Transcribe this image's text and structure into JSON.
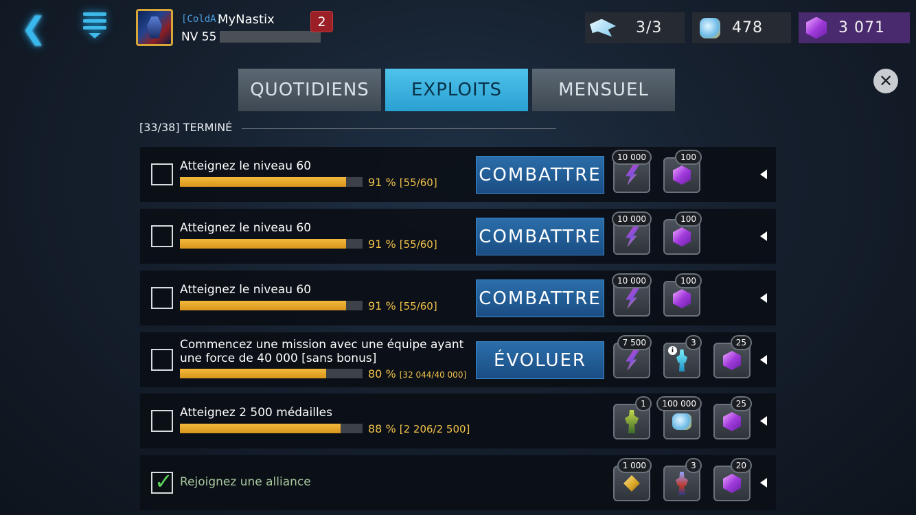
{
  "header": {
    "player_tag": "[ColdA]",
    "player_name": "MyNastix",
    "level": "NV 55",
    "notifications": "2",
    "resources": {
      "energy": "3/3",
      "crystals": "478",
      "gems": "3 071"
    }
  },
  "tabs": [
    {
      "label": "QUOTIDIENS",
      "active": false
    },
    {
      "label": "EXPLOITS",
      "active": true
    },
    {
      "label": "MENSUEL",
      "active": false
    }
  ],
  "summary": {
    "text": "[33/38] TERMINÉ"
  },
  "rows": [
    {
      "title": "Atteignez le niveau 60",
      "progress": 0.91,
      "percent": "91 %",
      "detail": "[55/60]",
      "button": "COMBATTRE",
      "completed": false,
      "rewards": [
        {
          "icon": "rainbow-bolt-icon",
          "count": "10 000"
        },
        {
          "icon": "purple-gem-icon",
          "count": "100"
        }
      ]
    },
    {
      "title": "Atteignez le niveau 60",
      "progress": 0.91,
      "percent": "91 %",
      "detail": "[55/60]",
      "button": "COMBATTRE",
      "completed": false,
      "rewards": [
        {
          "icon": "rainbow-bolt-icon",
          "count": "10 000"
        },
        {
          "icon": "purple-gem-icon",
          "count": "100"
        }
      ]
    },
    {
      "title": "Atteignez le niveau 60",
      "progress": 0.91,
      "percent": "91 %",
      "detail": "[55/60]",
      "button": "COMBATTRE",
      "completed": false,
      "rewards": [
        {
          "icon": "rainbow-bolt-icon",
          "count": "10 000"
        },
        {
          "icon": "purple-gem-icon",
          "count": "100"
        }
      ]
    },
    {
      "title_line1": "Commencez une mission avec une équipe ayant",
      "title_line2": "une force de 40 000 [sans bonus]",
      "progress": 0.8,
      "percent": "80 %",
      "detail": "[32 044/40 000]",
      "button": "ÉVOLUER",
      "completed": false,
      "rewards": [
        {
          "icon": "rainbow-bolt-icon",
          "count": "7 500"
        },
        {
          "icon": "blue-robot-icon",
          "count": "3"
        },
        {
          "icon": "purple-gem-icon",
          "count": "25"
        }
      ]
    },
    {
      "title": "Atteignez 2 500 médailles",
      "progress": 0.88,
      "percent": "88 %",
      "detail": "[2 206/2 500]",
      "completed": false,
      "rewards": [
        {
          "icon": "green-robot-icon",
          "count": "1"
        },
        {
          "icon": "crystal-icon",
          "count": "100 000"
        },
        {
          "icon": "purple-gem-icon",
          "count": "25"
        }
      ]
    },
    {
      "title": "Rejoignez une alliance",
      "completed": true,
      "rewards": [
        {
          "icon": "gold-medal-icon",
          "count": "1 000"
        },
        {
          "icon": "red-robot-icon",
          "count": "3"
        },
        {
          "icon": "purple-gem-icon",
          "count": "20"
        }
      ]
    }
  ]
}
